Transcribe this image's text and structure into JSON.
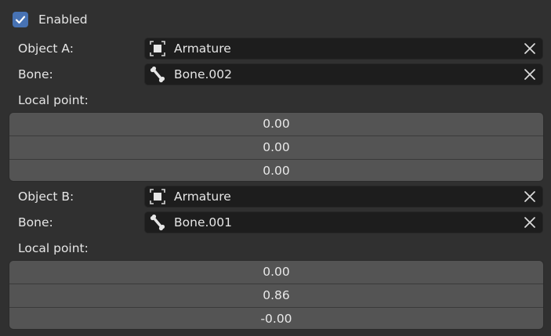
{
  "enabled": {
    "label": "Enabled",
    "checked": true,
    "accent": "#4772b3"
  },
  "object_a": {
    "label": "Object A:",
    "value": "Armature",
    "icon": "object-icon"
  },
  "bone_a": {
    "label": "Bone:",
    "value": "Bone.002",
    "icon": "bone-icon"
  },
  "local_point_a": {
    "label": "Local point:",
    "values": [
      "0.00",
      "0.00",
      "0.00"
    ]
  },
  "object_b": {
    "label": "Object B:",
    "value": "Armature",
    "icon": "object-icon"
  },
  "bone_b": {
    "label": "Bone:",
    "value": "Bone.001",
    "icon": "bone-icon"
  },
  "local_point_b": {
    "label": "Local point:",
    "values": [
      "0.00",
      "0.86",
      "-0.00"
    ]
  }
}
